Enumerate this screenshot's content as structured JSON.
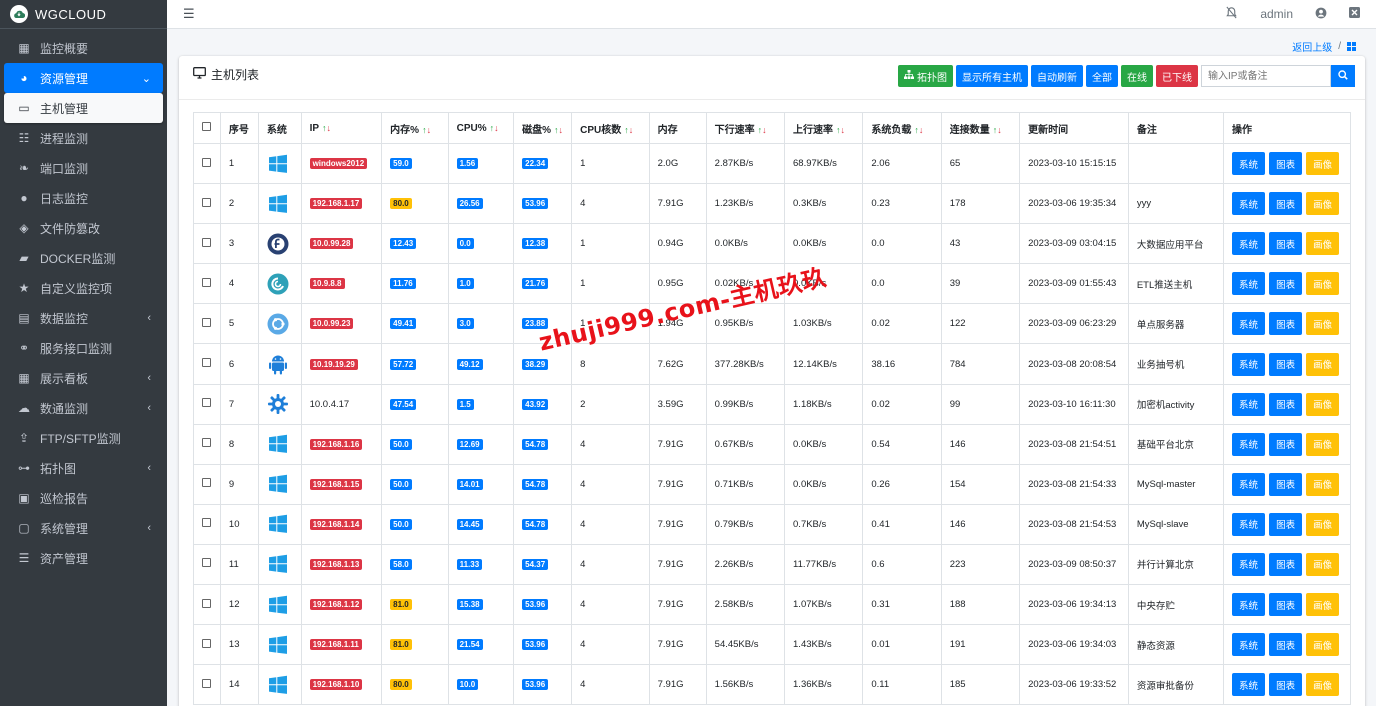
{
  "brand": {
    "name": "WGCLOUD"
  },
  "topbar": {
    "user": "admin",
    "icons": [
      "menu-icon",
      "bell-off-icon",
      "user-circle-icon",
      "close-square-icon"
    ]
  },
  "sidebar": {
    "items": [
      {
        "label": "监控概要",
        "icon": "dashboard-icon"
      },
      {
        "label": "资源管理",
        "icon": "palette-icon",
        "active": true,
        "expandable": true
      },
      {
        "label": "主机管理",
        "icon": "desktop-icon",
        "sub_active": true
      },
      {
        "label": "进程监测",
        "icon": "list-icon"
      },
      {
        "label": "端口监测",
        "icon": "leaf-icon"
      },
      {
        "label": "日志监控",
        "icon": "comment-icon"
      },
      {
        "label": "文件防篡改",
        "icon": "shield-icon"
      },
      {
        "label": "DOCKER监测",
        "icon": "docker-icon"
      },
      {
        "label": "自定义监控项",
        "icon": "star-icon"
      },
      {
        "label": "数据监控",
        "icon": "table-icon",
        "expandable": true
      },
      {
        "label": "服务接口监测",
        "icon": "link-icon"
      },
      {
        "label": "展示看板",
        "icon": "grid-icon",
        "expandable": true
      },
      {
        "label": "数通监测",
        "icon": "cloud-icon",
        "expandable": true
      },
      {
        "label": "FTP/SFTP监测",
        "icon": "upload-icon"
      },
      {
        "label": "拓扑图",
        "icon": "sitemap-icon",
        "expandable": true
      },
      {
        "label": "巡检报告",
        "icon": "calendar-icon"
      },
      {
        "label": "系统管理",
        "icon": "monitor-icon",
        "expandable": true
      },
      {
        "label": "资产管理",
        "icon": "server-icon"
      }
    ]
  },
  "breadcrumb": {
    "back": "返回上级",
    "sep": "/"
  },
  "card": {
    "title": "主机列表",
    "toolbar": {
      "topology": "拓扑图",
      "show_all": "显示所有主机",
      "auto_refresh": "自动刷新",
      "all": "全部",
      "online": "在线",
      "offline": "已下线",
      "search_placeholder": "输入IP或备注"
    }
  },
  "table": {
    "headers": [
      "序号",
      "系统",
      "IP",
      "内存%",
      "CPU%",
      "磁盘%",
      "CPU核数",
      "内存",
      "下行速率",
      "上行速率",
      "系统负载",
      "连接数量",
      "更新时间",
      "备注",
      "操作"
    ],
    "sort_up": "↑",
    "sort_down": "↓",
    "op_labels": {
      "system": "系统",
      "chart": "图表",
      "portrait": "画像"
    },
    "rows": [
      {
        "no": "1",
        "os": "windows",
        "ip": "windows2012",
        "ip_color": "red",
        "mem": "59.0",
        "mem_color": "blue",
        "cpu": "1.56",
        "disk": "22.34",
        "cores": "1",
        "ram": "2.0G",
        "down": "2.87KB/s",
        "up": "68.97KB/s",
        "load": "2.06",
        "conn": "65",
        "time": "2023-03-10 15:15:15",
        "note": ""
      },
      {
        "no": "2",
        "os": "windows",
        "ip": "192.168.1.17",
        "ip_color": "red",
        "mem": "80.0",
        "mem_color": "yellow",
        "cpu": "26.56",
        "disk": "53.96",
        "cores": "4",
        "ram": "7.91G",
        "down": "1.23KB/s",
        "up": "0.3KB/s",
        "load": "0.23",
        "conn": "178",
        "time": "2023-03-06 19:35:34",
        "note": "yyy"
      },
      {
        "no": "3",
        "os": "fedora",
        "ip": "10.0.99.28",
        "ip_color": "red",
        "mem": "12.43",
        "mem_color": "blue",
        "cpu": "0.0",
        "disk": "12.38",
        "cores": "1",
        "ram": "0.94G",
        "down": "0.0KB/s",
        "up": "0.0KB/s",
        "load": "0.0",
        "conn": "43",
        "time": "2023-03-09 03:04:15",
        "note": "大数据应用平台"
      },
      {
        "no": "4",
        "os": "debian",
        "ip": "10.9.8.8",
        "ip_color": "red",
        "mem": "11.76",
        "mem_color": "blue",
        "cpu": "1.0",
        "disk": "21.76",
        "cores": "1",
        "ram": "0.95G",
        "down": "0.02KB/s",
        "up": "0.0KB/s",
        "load": "0.0",
        "conn": "39",
        "time": "2023-03-09 01:55:43",
        "note": "ETL推送主机"
      },
      {
        "no": "5",
        "os": "ubuntu",
        "ip": "10.0.99.23",
        "ip_color": "red",
        "mem": "49.41",
        "mem_color": "blue",
        "cpu": "3.0",
        "disk": "23.88",
        "cores": "1",
        "ram": "1.94G",
        "down": "0.95KB/s",
        "up": "1.03KB/s",
        "load": "0.02",
        "conn": "122",
        "time": "2023-03-09 06:23:29",
        "note": "单点服务器"
      },
      {
        "no": "6",
        "os": "android",
        "ip": "10.19.19.29",
        "ip_color": "red",
        "mem": "57.72",
        "mem_color": "blue",
        "cpu": "49.12",
        "disk": "38.29",
        "cores": "8",
        "ram": "7.62G",
        "down": "377.28KB/s",
        "up": "12.14KB/s",
        "load": "38.16",
        "conn": "784",
        "time": "2023-03-08 20:08:54",
        "note": "业务抽号机"
      },
      {
        "no": "7",
        "os": "gear",
        "ip": "10.0.4.17",
        "ip_color": "none",
        "mem": "47.54",
        "mem_color": "blue",
        "cpu": "1.5",
        "disk": "43.92",
        "cores": "2",
        "ram": "3.59G",
        "down": "0.99KB/s",
        "up": "1.18KB/s",
        "load": "0.02",
        "conn": "99",
        "time": "2023-03-10 16:11:30",
        "note": "加密机activity"
      },
      {
        "no": "8",
        "os": "windows",
        "ip": "192.168.1.16",
        "ip_color": "red",
        "mem": "50.0",
        "mem_color": "blue",
        "cpu": "12.69",
        "disk": "54.78",
        "cores": "4",
        "ram": "7.91G",
        "down": "0.67KB/s",
        "up": "0.0KB/s",
        "load": "0.54",
        "conn": "146",
        "time": "2023-03-08 21:54:51",
        "note": "基础平台北京"
      },
      {
        "no": "9",
        "os": "windows",
        "ip": "192.168.1.15",
        "ip_color": "red",
        "mem": "50.0",
        "mem_color": "blue",
        "cpu": "14.01",
        "disk": "54.78",
        "cores": "4",
        "ram": "7.91G",
        "down": "0.71KB/s",
        "up": "0.0KB/s",
        "load": "0.26",
        "conn": "154",
        "time": "2023-03-08 21:54:33",
        "note": "MySql-master"
      },
      {
        "no": "10",
        "os": "windows",
        "ip": "192.168.1.14",
        "ip_color": "red",
        "mem": "50.0",
        "mem_color": "blue",
        "cpu": "14.45",
        "disk": "54.78",
        "cores": "4",
        "ram": "7.91G",
        "down": "0.79KB/s",
        "up": "0.7KB/s",
        "load": "0.41",
        "conn": "146",
        "time": "2023-03-08 21:54:53",
        "note": "MySql-slave"
      },
      {
        "no": "11",
        "os": "windows",
        "ip": "192.168.1.13",
        "ip_color": "red",
        "mem": "58.0",
        "mem_color": "blue",
        "cpu": "11.33",
        "disk": "54.37",
        "cores": "4",
        "ram": "7.91G",
        "down": "2.26KB/s",
        "up": "11.77KB/s",
        "load": "0.6",
        "conn": "223",
        "time": "2023-03-09 08:50:37",
        "note": "并行计算北京"
      },
      {
        "no": "12",
        "os": "windows",
        "ip": "192.168.1.12",
        "ip_color": "red",
        "mem": "81.0",
        "mem_color": "yellow",
        "cpu": "15.38",
        "disk": "53.96",
        "cores": "4",
        "ram": "7.91G",
        "down": "2.58KB/s",
        "up": "1.07KB/s",
        "load": "0.31",
        "conn": "188",
        "time": "2023-03-06 19:34:13",
        "note": "中央存贮"
      },
      {
        "no": "13",
        "os": "windows",
        "ip": "192.168.1.11",
        "ip_color": "red",
        "mem": "81.0",
        "mem_color": "yellow",
        "cpu": "21.54",
        "disk": "53.96",
        "cores": "4",
        "ram": "7.91G",
        "down": "54.45KB/s",
        "up": "1.43KB/s",
        "load": "0.01",
        "conn": "191",
        "time": "2023-03-06 19:34:03",
        "note": "静态资源"
      },
      {
        "no": "14",
        "os": "windows",
        "ip": "192.168.1.10",
        "ip_color": "red",
        "mem": "80.0",
        "mem_color": "yellow",
        "cpu": "10.0",
        "disk": "53.96",
        "cores": "4",
        "ram": "7.91G",
        "down": "1.56KB/s",
        "up": "1.36KB/s",
        "load": "0.11",
        "conn": "185",
        "time": "2023-03-06 19:33:52",
        "note": "资源审批备份"
      }
    ]
  },
  "watermark": "zhuji999.com-主机玖玖",
  "colors": {
    "sidebar_bg": "#343a40",
    "primary": "#007bff",
    "success": "#28a745",
    "danger": "#dc3545",
    "warning": "#ffc107",
    "topology_btn": "#28a745"
  }
}
